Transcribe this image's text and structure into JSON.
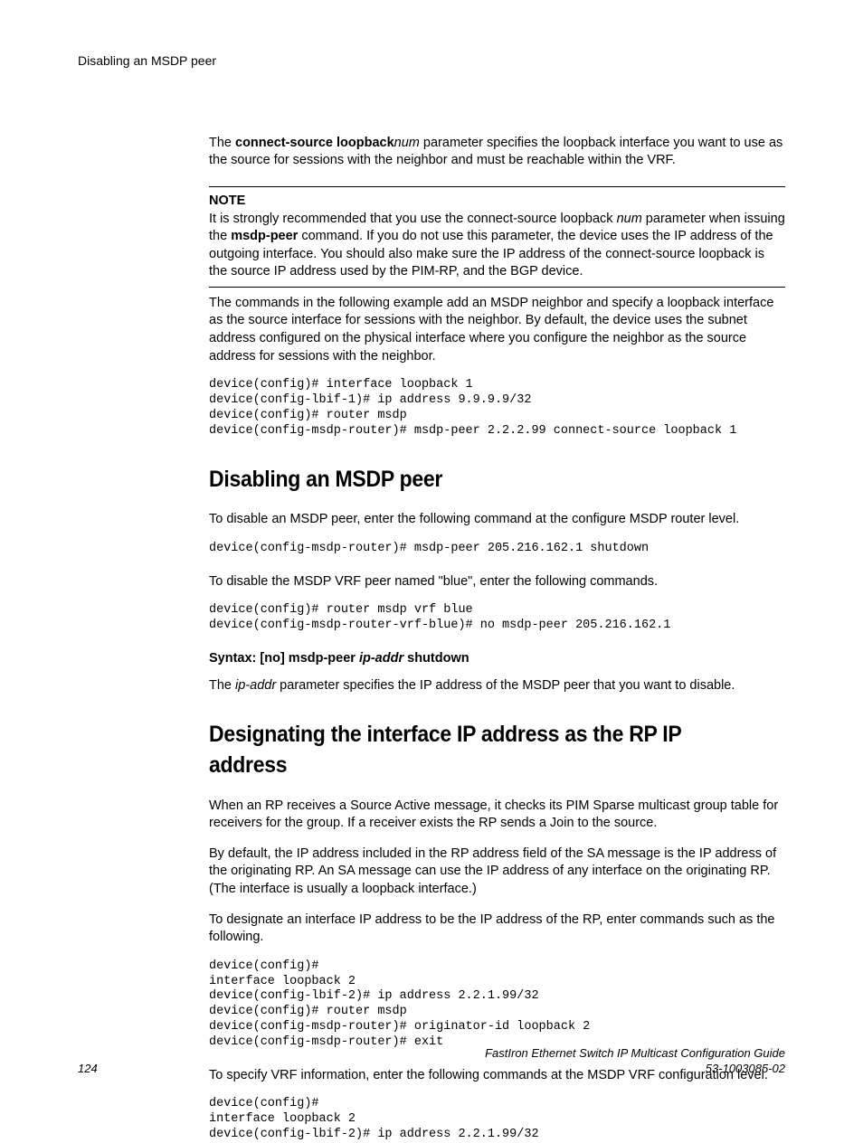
{
  "header": {
    "running_head": "Disabling an MSDP peer"
  },
  "intro": {
    "p1_pre": "The ",
    "p1_code1": "connect-source loopback",
    "p1_ital1": "num",
    "p1_post": " parameter specifies the loopback interface you want to use as the source for sessions with the neighbor and must be reachable within the VRF."
  },
  "note": {
    "label": "NOTE",
    "p_pre": "It is strongly recommended that you use the connect-source loopback ",
    "p_ital": "num",
    "p_mid": " parameter when issuing the ",
    "p_code": "msdp-peer",
    "p_post": " command. If you do not use this parameter, the device uses the IP address of the outgoing interface. You should also make sure the IP address of the connect-source loopback is the source IP address used by the PIM-RP, and the BGP device."
  },
  "after_note_p": "The commands in the following example add an MSDP neighbor and specify a loopback interface as the source interface for sessions with the neighbor. By default, the device uses the subnet address configured on the physical interface where you configure the neighbor as the source address for sessions with the neighbor.",
  "code1": "device(config)# interface loopback 1\ndevice(config-lbif-1)# ip address 9.9.9.9/32\ndevice(config)# router msdp\ndevice(config-msdp-router)# msdp-peer 2.2.2.99 connect-source loopback 1",
  "sect1": {
    "title": "Disabling an MSDP peer",
    "p1": "To disable an MSDP peer, enter the following command at the configure MSDP router level.",
    "code1": "device(config-msdp-router)# msdp-peer 205.216.162.1 shutdown",
    "p2": "To disable the MSDP VRF peer named \"blue\", enter the following commands.",
    "code2": "device(config)# router msdp vrf blue\ndevice(config-msdp-router-vrf-blue)# no msdp-peer 205.216.162.1",
    "syntax_pre": "Syntax: [no] msdp-peer ",
    "syntax_ital": "ip-addr",
    "syntax_post": " shutdown",
    "p3_pre": "The ",
    "p3_ital": "ip-addr",
    "p3_post": " parameter specifies the IP address of the MSDP peer that you want to disable."
  },
  "sect2": {
    "title": "Designating the interface IP address as the RP IP address",
    "p1": "When an RP receives a Source Active message, it checks its PIM Sparse multicast group table for receivers for the group. If a receiver exists the RP sends a Join to the source.",
    "p2": "By default, the IP address included in the RP address field of the SA message is the IP address of the originating RP. An SA message can use the IP address of any interface on the originating RP. (The interface is usually a loopback interface.)",
    "p3": "To designate an interface IP address to be the IP address of the RP, enter commands such as the following.",
    "code1": "device(config)#\ninterface loopback 2\ndevice(config-lbif-2)# ip address 2.2.1.99/32\ndevice(config)# router msdp\ndevice(config-msdp-router)# originator-id loopback 2\ndevice(config-msdp-router)# exit",
    "p4": "To specify VRF information, enter the following commands at the MSDP VRF configuration level.",
    "code2": "device(config)#\ninterface loopback 2\ndevice(config-lbif-2)# ip address 2.2.1.99/32"
  },
  "footer": {
    "page_num": "124",
    "title": "FastIron Ethernet Switch IP Multicast Configuration Guide",
    "doc_id": "53-1003085-02"
  }
}
